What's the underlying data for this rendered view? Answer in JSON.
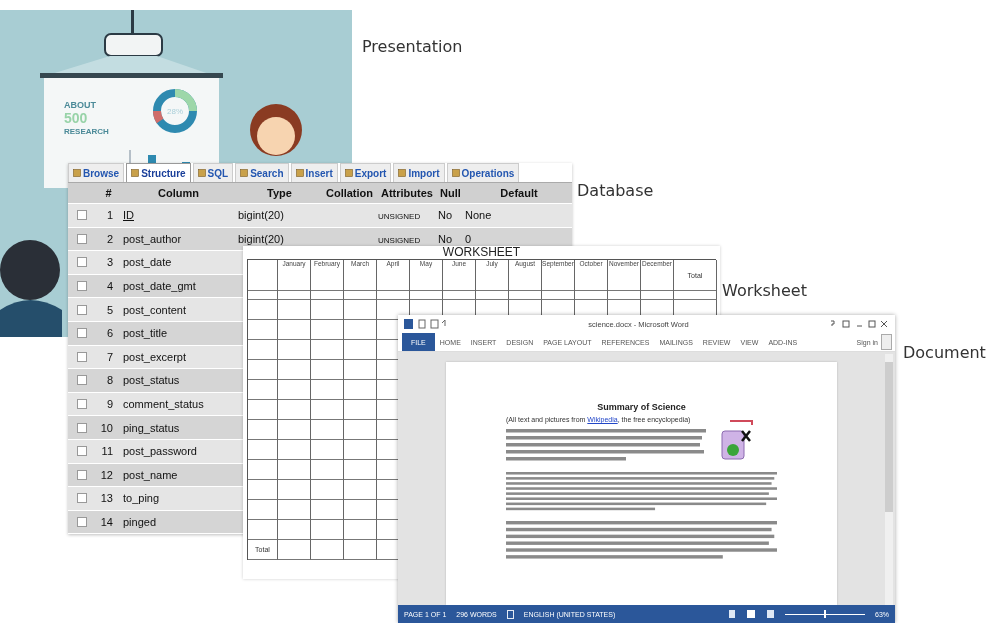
{
  "presentation": {
    "caption": "Presentation",
    "slide": {
      "line_1": "ABOUT",
      "line_2": "500",
      "line_3": "RESEARCH",
      "donut_label": "28%"
    }
  },
  "database": {
    "caption": "Database",
    "tabs": [
      {
        "label": "Browse",
        "selected": false
      },
      {
        "label": "Structure",
        "selected": true
      },
      {
        "label": "SQL",
        "selected": false
      },
      {
        "label": "Search",
        "selected": false
      },
      {
        "label": "Insert",
        "selected": false
      },
      {
        "label": "Export",
        "selected": false
      },
      {
        "label": "Import",
        "selected": false
      },
      {
        "label": "Operations",
        "selected": false
      }
    ],
    "columns": [
      "#",
      "Column",
      "Type",
      "Collation",
      "Attributes",
      "Null",
      "Default"
    ],
    "rows": [
      {
        "number": "1",
        "name": "ID",
        "primary": true,
        "checked": false,
        "type": "bigint(20)",
        "attributes": "UNSIGNED",
        "null": "No",
        "default": "None"
      },
      {
        "number": "2",
        "name": "post_author",
        "primary": false,
        "checked": false,
        "type": "bigint(20)",
        "attributes": "UNSIGNED",
        "null": "No",
        "default": "0"
      },
      {
        "number": "3",
        "name": "post_date",
        "primary": false,
        "checked": false
      },
      {
        "number": "4",
        "name": "post_date_gmt",
        "primary": false,
        "checked": false
      },
      {
        "number": "5",
        "name": "post_content",
        "primary": false,
        "checked": false
      },
      {
        "number": "6",
        "name": "post_title",
        "primary": false,
        "checked": false
      },
      {
        "number": "7",
        "name": "post_excerpt",
        "primary": false,
        "checked": false
      },
      {
        "number": "8",
        "name": "post_status",
        "primary": false,
        "checked": false
      },
      {
        "number": "9",
        "name": "comment_status",
        "primary": false,
        "checked": false
      },
      {
        "number": "10",
        "name": "ping_status",
        "primary": false,
        "checked": false
      },
      {
        "number": "11",
        "name": "post_password",
        "primary": false,
        "checked": false
      },
      {
        "number": "12",
        "name": "post_name",
        "primary": false,
        "checked": false
      },
      {
        "number": "13",
        "name": "to_ping",
        "primary": false,
        "checked": false
      },
      {
        "number": "14",
        "name": "pinged",
        "primary": false,
        "checked": false
      }
    ]
  },
  "worksheet": {
    "caption": "Worksheet",
    "title": "WORKSHEET",
    "months": [
      "January",
      "February",
      "March",
      "April",
      "May",
      "June",
      "July",
      "August",
      "September",
      "October",
      "November",
      "December"
    ],
    "total_heading": "Total",
    "footer_label": "Total"
  },
  "document": {
    "caption": "Document",
    "title": "science.docx - Microsoft Word",
    "ribbon_tabs": [
      {
        "label": "FILE",
        "selected": true
      },
      {
        "label": "HOME",
        "selected": false
      },
      {
        "label": "INSERT",
        "selected": false
      },
      {
        "label": "DESIGN",
        "selected": false
      },
      {
        "label": "PAGE LAYOUT",
        "selected": false
      },
      {
        "label": "REFERENCES",
        "selected": false
      },
      {
        "label": "MAILINGS",
        "selected": false
      },
      {
        "label": "REVIEW",
        "selected": false
      },
      {
        "label": "VIEW",
        "selected": false
      },
      {
        "label": "ADD-INS",
        "selected": false
      }
    ],
    "sign_in": "Sign in",
    "heading": "Summary of Science",
    "source_before": "(All text and pictures from ",
    "source_link": "Wikipedia",
    "source_after": ", the free encyclopedia)",
    "status_bar": {
      "page": "PAGE 1 OF 1",
      "words": "296 WORDS",
      "language": "ENGLISH (UNITED STATES)",
      "zoom": "63%",
      "zoom_slider": {
        "level": 0.5
      }
    }
  }
}
